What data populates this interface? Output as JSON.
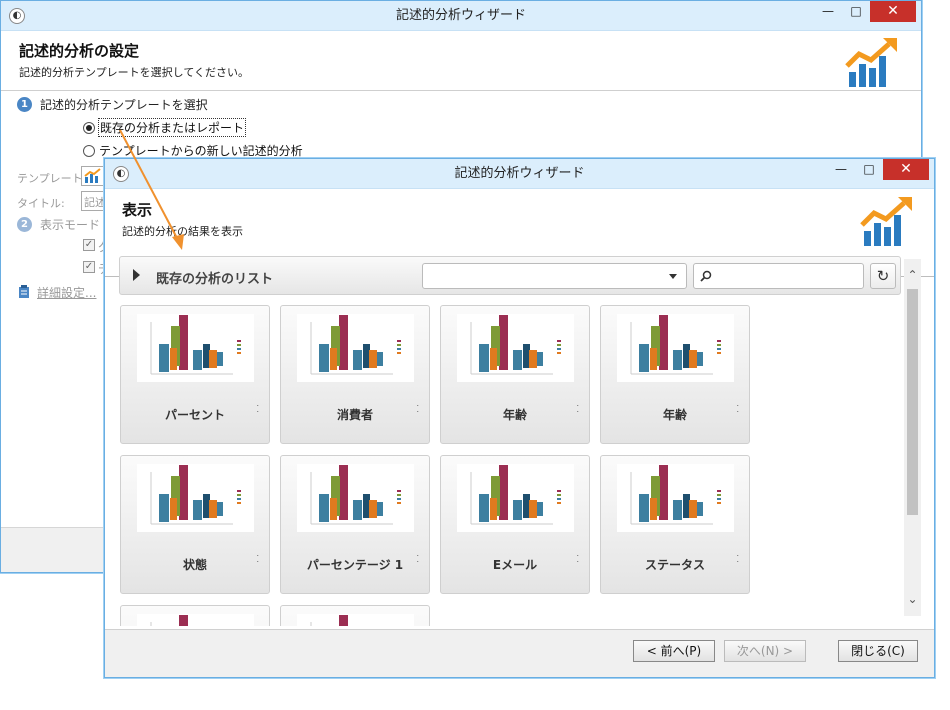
{
  "back_window": {
    "title": "記述的分析ウィザード",
    "header_title": "記述的分析の設定",
    "header_subtitle": "記述的分析テンプレートを選択してください。",
    "step1": {
      "num": "1",
      "label": "記述的分析テンプレートを選択"
    },
    "radio_existing": "既存の分析またはレポート",
    "radio_new": "テンプレートからの新しい記述的分析",
    "template_label": "テンプレート:",
    "title_label": "タイトル:",
    "title_value": "記述",
    "step2": {
      "num": "2",
      "label": "表示モード"
    },
    "check1_text": "グ",
    "check2_text": "デ",
    "advanced_link": "詳細設定..."
  },
  "front_window": {
    "title": "記述的分析ウィザード",
    "header_title": "表示",
    "header_subtitle": "記述的分析の結果を表示",
    "list_title": "既存の分析のリスト",
    "select_value": "",
    "search_value": "",
    "tiles": [
      {
        "label": "パーセント"
      },
      {
        "label": "消費者"
      },
      {
        "label": "年齢"
      },
      {
        "label": "年齢"
      },
      {
        "label": "状態"
      },
      {
        "label": "パーセンテージ 1"
      },
      {
        "label": "Eメール"
      },
      {
        "label": "ステータス"
      },
      {
        "label": ""
      },
      {
        "label": ""
      }
    ],
    "btn_prev": "< 前へ(P)",
    "btn_next": "次へ(N) >",
    "btn_close": "閉じる(C)"
  },
  "colors": {
    "titlebar": "#dbeefc",
    "close_button": "#c7302a",
    "step_badge": "#4a86c5",
    "annotation_arrow": "#f0912e",
    "logo_blue": "#2a7bc0",
    "logo_orange": "#f39a1f"
  },
  "icons": {
    "app": "wizard-app-icon",
    "logo": "analysis-chart-logo-icon",
    "search": "search-icon",
    "refresh": "refresh-icon",
    "expand": "expand-triangle-icon"
  }
}
